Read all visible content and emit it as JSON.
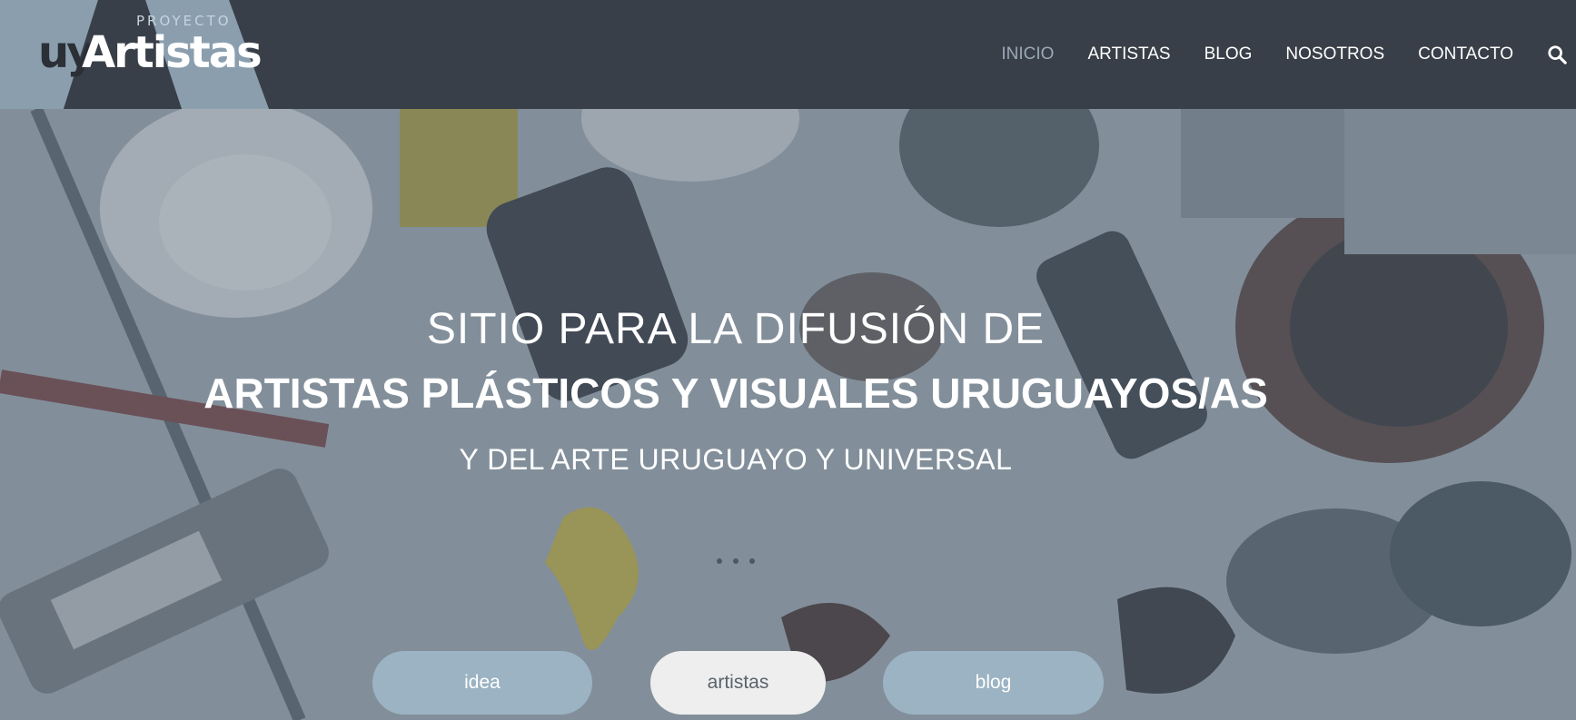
{
  "logo": {
    "top_text": "PROYECTO",
    "uy": "uy",
    "name": "Artistas"
  },
  "nav": {
    "items": [
      "INICIO",
      "ARTISTAS",
      "BLOG",
      "NOSOTROS",
      "CONTACTO"
    ],
    "active": "INICIO",
    "search_icon": "search-icon"
  },
  "hero": {
    "line1": "SITIO PARA LA DIFUSIÓN DE",
    "line2": "ARTISTAS PLÁSTICOS Y VISUALES URUGUAYOS/AS",
    "line3": "Y DEL ARTE URUGUAYO Y UNIVERSAL"
  },
  "buttons": {
    "idea": "idea",
    "artistas": "artistas",
    "blog": "blog"
  },
  "colors": {
    "header_bg": "#393f48",
    "logo_bg": "#8a9eae",
    "nav_active": "#9aa9b6",
    "button_blue": "#9bb3c2",
    "button_light": "#eeeeee"
  }
}
